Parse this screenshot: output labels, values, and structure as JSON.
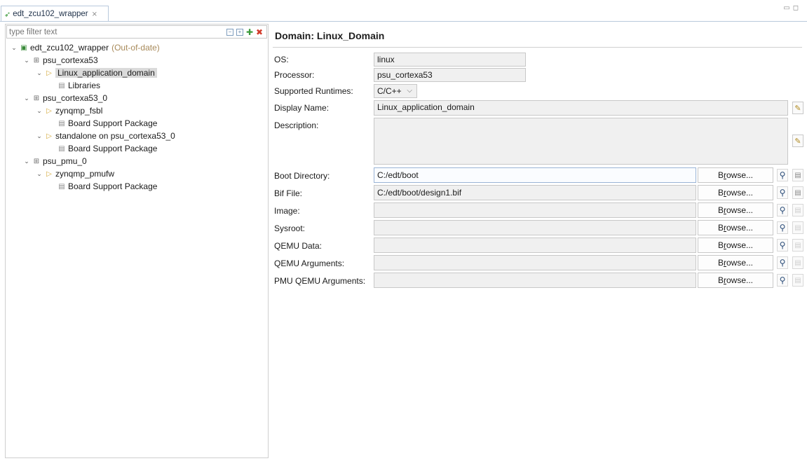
{
  "tab": {
    "title": "edt_zcu102_wrapper",
    "close_glyph": "⨯"
  },
  "filter": {
    "placeholder": "type filter text"
  },
  "tree": [
    {
      "level": 0,
      "expanded": true,
      "icon": "project-icon",
      "label": "edt_zcu102_wrapper",
      "note": "(Out-of-date)"
    },
    {
      "level": 1,
      "expanded": true,
      "icon": "processor-icon",
      "label": "psu_cortexa53"
    },
    {
      "level": 2,
      "expanded": true,
      "icon": "domain-folder-icon",
      "label": "Linux_application_domain",
      "selected": true
    },
    {
      "level": 3,
      "expanded": null,
      "icon": "library-icon",
      "label": "Libraries"
    },
    {
      "level": 1,
      "expanded": true,
      "icon": "processor-icon",
      "label": "psu_cortexa53_0"
    },
    {
      "level": 2,
      "expanded": true,
      "icon": "domain-folder-icon",
      "label": "zynqmp_fsbl"
    },
    {
      "level": 3,
      "expanded": null,
      "icon": "library-icon",
      "label": "Board Support Package"
    },
    {
      "level": 2,
      "expanded": true,
      "icon": "domain-folder-icon",
      "label": "standalone on psu_cortexa53_0"
    },
    {
      "level": 3,
      "expanded": null,
      "icon": "library-icon",
      "label": "Board Support Package"
    },
    {
      "level": 1,
      "expanded": true,
      "icon": "processor-icon",
      "label": "psu_pmu_0"
    },
    {
      "level": 2,
      "expanded": true,
      "icon": "domain-folder-icon",
      "label": "zynqmp_pmufw"
    },
    {
      "level": 3,
      "expanded": null,
      "icon": "library-icon",
      "label": "Board Support Package"
    }
  ],
  "domain": {
    "title": "Domain: Linux_Domain",
    "os": {
      "label": "OS:",
      "value": "linux"
    },
    "processor": {
      "label": "Processor:",
      "value": "psu_cortexa53"
    },
    "runtimes": {
      "label": "Supported Runtimes:",
      "value": "C/C++"
    },
    "display_name": {
      "label": "Display Name:",
      "value": "Linux_application_domain"
    },
    "description": {
      "label": "Description:",
      "value": ""
    },
    "browse_label_pre": "B",
    "browse_label_u": "r",
    "browse_label_post": "owse...",
    "paths": [
      {
        "label": "Boot Directory:",
        "value": "C:/edt/boot",
        "clear_enabled": true
      },
      {
        "label": "Bif File:",
        "value": "C:/edt/boot/design1.bif",
        "clear_enabled": true
      },
      {
        "label": "Image:",
        "value": "",
        "clear_enabled": false
      },
      {
        "label": "Sysroot:",
        "value": "",
        "clear_enabled": false
      },
      {
        "label": "QEMU Data:",
        "value": "",
        "clear_enabled": false
      },
      {
        "label": "QEMU Arguments:",
        "value": "",
        "clear_enabled": false
      },
      {
        "label": "PMU QEMU Arguments:",
        "value": "",
        "clear_enabled": false
      }
    ]
  }
}
